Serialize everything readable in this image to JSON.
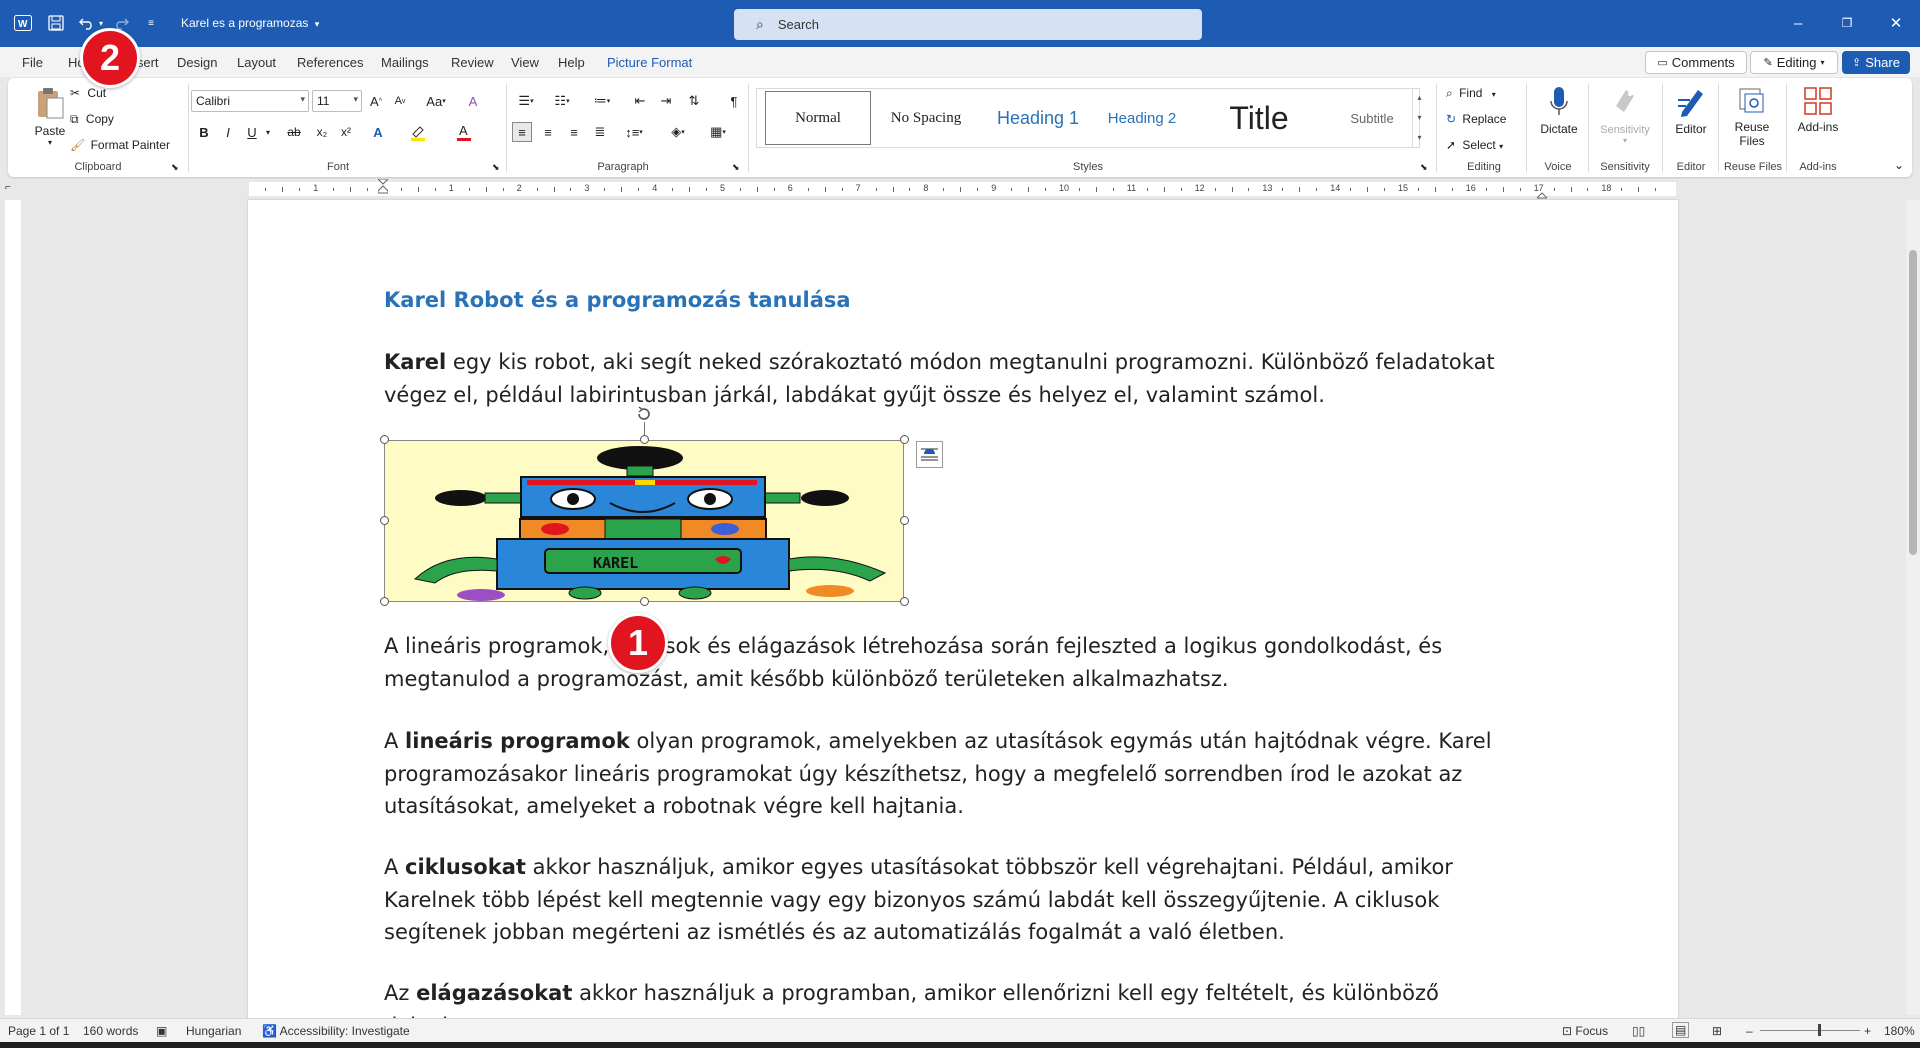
{
  "titlebar": {
    "doc_title": "Karel es a programozas",
    "search_placeholder": "Search"
  },
  "menu": {
    "tabs": [
      "File",
      "Home",
      "Insert",
      "Design",
      "Layout",
      "References",
      "Mailings",
      "Review",
      "View",
      "Help",
      "Picture Format"
    ],
    "comments_label": "Comments",
    "editing_label": "Editing",
    "share_label": "Share"
  },
  "ribbon": {
    "clipboard": {
      "paste": "Paste",
      "cut": "Cut",
      "copy": "Copy",
      "format_painter": "Format Painter",
      "label": "Clipboard"
    },
    "font": {
      "family": "Calibri",
      "size": "11",
      "label": "Font"
    },
    "paragraph": {
      "label": "Paragraph"
    },
    "styles": {
      "items": [
        "Normal",
        "No Spacing",
        "Heading 1",
        "Heading 2",
        "Title",
        "Subtitle"
      ],
      "label": "Styles"
    },
    "editing": {
      "find": "Find",
      "replace": "Replace",
      "select": "Select",
      "label": "Editing"
    },
    "voice": {
      "dictate": "Dictate",
      "label": "Voice"
    },
    "sensitivity": {
      "button": "Sensitivity",
      "label": "Sensitivity"
    },
    "editor": {
      "button": "Editor",
      "label": "Editor"
    },
    "reuse": {
      "button_line1": "Reuse",
      "button_line2": "Files",
      "label": "Reuse Files"
    },
    "addins": {
      "button": "Add-ins",
      "label": "Add-ins"
    }
  },
  "ruler_numbers": [
    "2",
    "1",
    "1",
    "2",
    "3",
    "4",
    "5",
    "6",
    "7",
    "8",
    "9",
    "10",
    "11",
    "12",
    "13",
    "14",
    "15",
    "16",
    "17",
    "18"
  ],
  "document": {
    "heading": "Karel Robot és a programozás tanulása",
    "p1_bold": "Karel",
    "p1_rest": " egy kis robot, aki segít neked szórakoztató módon megtanulni programozni. Különböző feladatokat végez el, például labirintusban járkál, labdákat gyűjt össze és helyez el, valamint számol.",
    "robot_label": "KAREL",
    "p2": "A lineáris programok, ciklusok és elágazások létrehozása során fejleszted a logikus gondolkodást, és megtanulod a programozást, amit később különböző területeken alkalmazhatsz.",
    "p3_pre": "A ",
    "p3_bold": "lineáris programok",
    "p3_rest": " olyan programok, amelyekben az utasítások egymás után hajtódnak végre. Karel programozásakor lineáris programokat úgy készíthetsz, hogy a megfelelő sorrendben írod le azokat az utasításokat, amelyeket a robotnak végre kell hajtania.",
    "p4_pre": "A ",
    "p4_bold": "ciklusokat",
    "p4_rest": " akkor használjuk, amikor egyes utasításokat többször kell végrehajtani. Például, amikor Karelnek több lépést kell megtennie vagy egy bizonyos számú labdát kell összegyűjtenie. A ciklusok segítenek jobban megérteni az ismétlés és az automatizálás fogalmát a való életben.",
    "p5_pre": "Az ",
    "p5_bold": "elágazásokat",
    "p5_rest": " akkor használjuk a programban, amikor ellenőrizni kell egy feltételt, és különböző dolgokat"
  },
  "badges": {
    "one": "1",
    "two": "2"
  },
  "status": {
    "page": "Page 1 of 1",
    "words": "160 words",
    "language": "Hungarian",
    "accessibility": "Accessibility: Investigate",
    "focus": "Focus",
    "zoom": "180%"
  },
  "colors": {
    "accent": "#1e5cb3",
    "heading": "#2a72b8",
    "badge": "#e0151f"
  }
}
